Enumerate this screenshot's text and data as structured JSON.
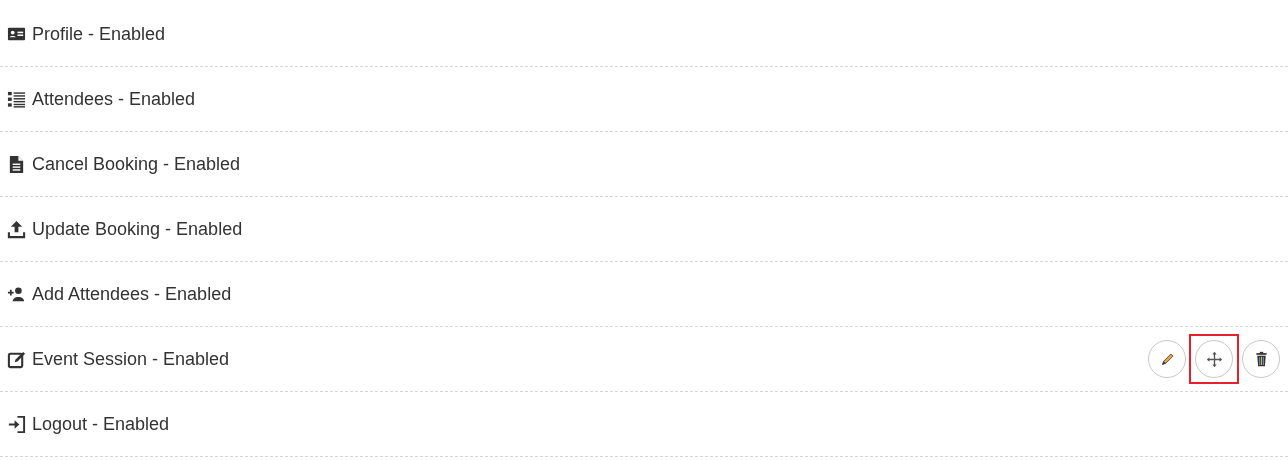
{
  "items": [
    {
      "label": "Profile - Enabled"
    },
    {
      "label": "Attendees - Enabled"
    },
    {
      "label": "Cancel Booking - Enabled"
    },
    {
      "label": "Update Booking - Enabled"
    },
    {
      "label": "Add Attendees - Enabled"
    },
    {
      "label": "Event Session - Enabled",
      "actions": [
        {
          "kind": "edit",
          "highlighted": false
        },
        {
          "kind": "move",
          "highlighted": true
        },
        {
          "kind": "delete",
          "highlighted": false
        }
      ]
    },
    {
      "label": "Logout - Enabled"
    }
  ]
}
